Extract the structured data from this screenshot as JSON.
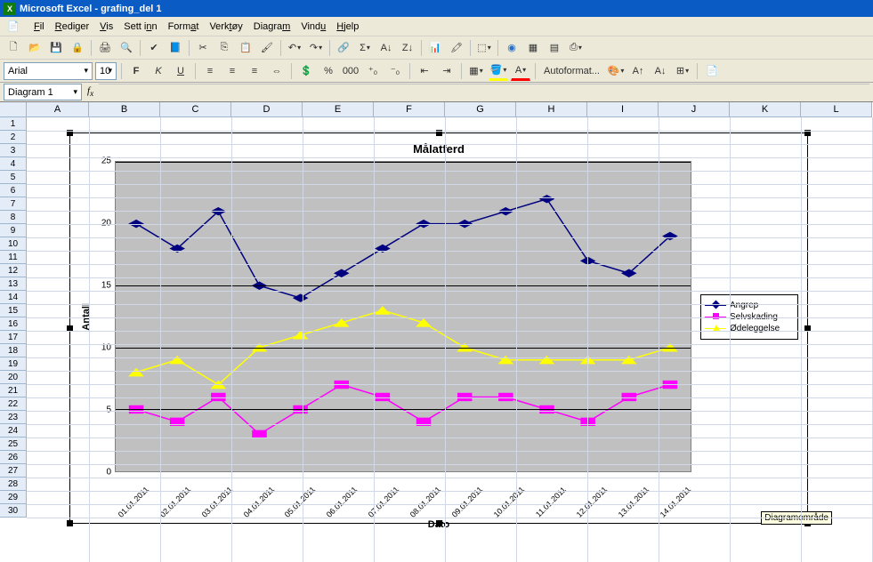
{
  "window": {
    "title": "Microsoft Excel - grafing_del 1"
  },
  "menu": {
    "items": [
      "Fil",
      "Rediger",
      "Vis",
      "Sett inn",
      "Format",
      "Verktøy",
      "Diagram",
      "Vindu",
      "Hjelp"
    ]
  },
  "format": {
    "font": "Arial",
    "size": "10",
    "autoformat": "Autoformat..."
  },
  "namebox": "Diagram 1",
  "columns": [
    "A",
    "B",
    "C",
    "D",
    "E",
    "F",
    "G",
    "H",
    "I",
    "J",
    "K",
    "L"
  ],
  "rows_count": 30,
  "chart": {
    "tooltip": "Diagramområde"
  },
  "chart_data": {
    "type": "line",
    "title": "Målatferd",
    "xlabel": "Dato",
    "ylabel": "Antall",
    "ylim": [
      0,
      25
    ],
    "yticks": [
      0,
      5,
      10,
      15,
      20,
      25
    ],
    "categories": [
      "01.01.2011",
      "02.01.2011",
      "03.01.2011",
      "04.01.2011",
      "05.01.2011",
      "06.01.2011",
      "07.01.2011",
      "08.01.2011",
      "09.01.2011",
      "10.01.2011",
      "11.01.2011",
      "12.01.2011",
      "13.01.2011",
      "14.01.2011"
    ],
    "series": [
      {
        "name": "Angrep",
        "color": "#000080",
        "marker": "diamond",
        "values": [
          20,
          18,
          21,
          15,
          14,
          16,
          18,
          20,
          20,
          21,
          22,
          17,
          16,
          19
        ]
      },
      {
        "name": "Selvskading",
        "color": "#ff00ff",
        "marker": "square",
        "values": [
          5,
          4,
          6,
          3,
          5,
          7,
          6,
          4,
          6,
          6,
          5,
          4,
          6,
          7
        ]
      },
      {
        "name": "Ødeleggelse",
        "color": "#ffff00",
        "marker": "triangle",
        "values": [
          8,
          9,
          7,
          10,
          11,
          12,
          13,
          12,
          10,
          9,
          9,
          9,
          9,
          10
        ]
      }
    ]
  }
}
